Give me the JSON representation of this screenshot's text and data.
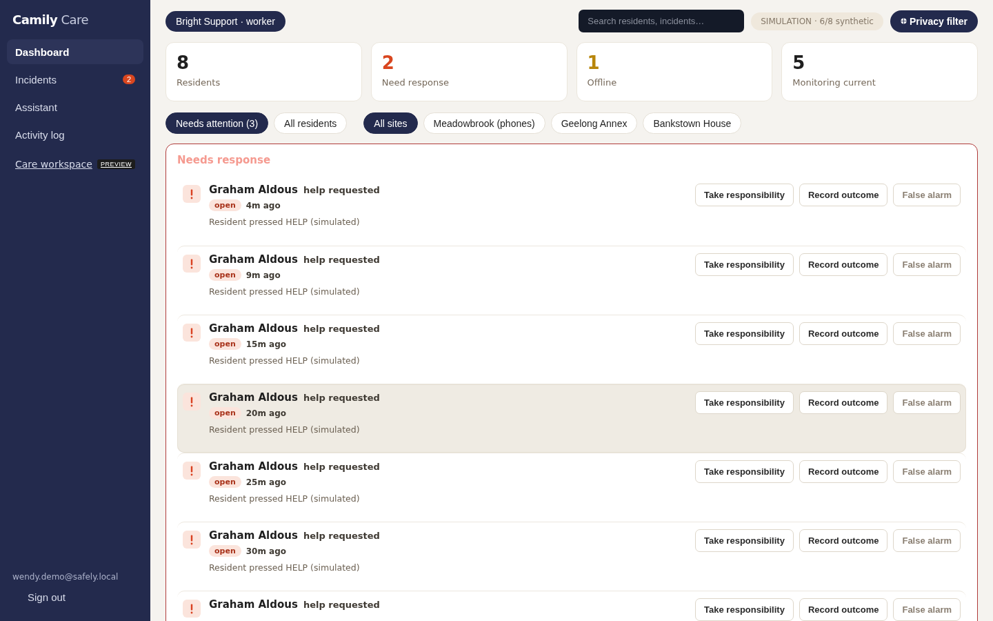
{
  "sidebar": {
    "brand": {
      "bold": "Camily",
      "light": "Care"
    },
    "items": [
      {
        "label": "Dashboard",
        "selected": true
      },
      {
        "label": "Incidents",
        "selected": false,
        "badge": "2"
      },
      {
        "label": "Assistant",
        "selected": false
      },
      {
        "label": "Activity log",
        "selected": false
      }
    ],
    "workspace_link": {
      "label": "Care workspace",
      "tag": "PREVIEW"
    },
    "user_email": "wendy.demo@safely.local",
    "sign_out": "Sign out"
  },
  "topbar": {
    "org": "Bright Support · worker",
    "search": {
      "placeholder": "Search residents, incidents…"
    },
    "simulation": "SIMULATION · 6/8 synthetic",
    "privacy_button": "Privacy filter"
  },
  "stats": [
    {
      "value": "8",
      "label": "Residents",
      "color": "#1f1f1f"
    },
    {
      "value": "2",
      "label": "Need response",
      "color": "#d9461f"
    },
    {
      "value": "1",
      "label": "Offline",
      "color": "#b8860b"
    },
    {
      "value": "5",
      "label": "Monitoring current",
      "color": "#1f1f1f"
    }
  ],
  "filters": [
    {
      "label": "Needs attention (3)",
      "selected": true
    },
    {
      "label": "All residents",
      "selected": false
    }
  ],
  "sites": [
    {
      "label": "All sites",
      "selected": true
    },
    {
      "label": "Meadowbrook (phones)",
      "selected": false
    },
    {
      "label": "Geelong Annex",
      "selected": false
    },
    {
      "label": "Bankstown House",
      "selected": false
    }
  ],
  "panel": {
    "title": "Needs response",
    "incidents": [
      {
        "name": "Graham Aldous",
        "event": "help requested",
        "status": "open",
        "time": "4m ago",
        "detail": "Resident pressed HELP (simulated)",
        "highlighted": false,
        "actions": [
          "Take responsibility",
          "Record outcome",
          "False alarm"
        ]
      },
      {
        "name": "Graham Aldous",
        "event": "help requested",
        "status": "open",
        "time": "9m ago",
        "detail": "Resident pressed HELP (simulated)",
        "highlighted": false,
        "actions": [
          "Take responsibility",
          "Record outcome",
          "False alarm"
        ]
      },
      {
        "name": "Graham Aldous",
        "event": "help requested",
        "status": "open",
        "time": "15m ago",
        "detail": "Resident pressed HELP (simulated)",
        "highlighted": false,
        "actions": [
          "Take responsibility",
          "Record outcome",
          "False alarm"
        ]
      },
      {
        "name": "Graham Aldous",
        "event": "help requested",
        "status": "open",
        "time": "20m ago",
        "detail": "Resident pressed HELP (simulated)",
        "highlighted": true,
        "actions": [
          "Take responsibility",
          "Record outcome",
          "False alarm"
        ]
      },
      {
        "name": "Graham Aldous",
        "event": "help requested",
        "status": "open",
        "time": "25m ago",
        "detail": "Resident pressed HELP (simulated)",
        "highlighted": false,
        "actions": [
          "Take responsibility",
          "Record outcome",
          "False alarm"
        ]
      },
      {
        "name": "Graham Aldous",
        "event": "help requested",
        "status": "open",
        "time": "30m ago",
        "detail": "Resident pressed HELP (simulated)",
        "highlighted": false,
        "actions": [
          "Take responsibility",
          "Record outcome",
          "False alarm"
        ]
      },
      {
        "name": "Graham Aldous",
        "event": "help requested",
        "highlighted": false,
        "actions": [
          "Take responsibility",
          "Record outcome",
          "False alarm"
        ]
      }
    ]
  }
}
